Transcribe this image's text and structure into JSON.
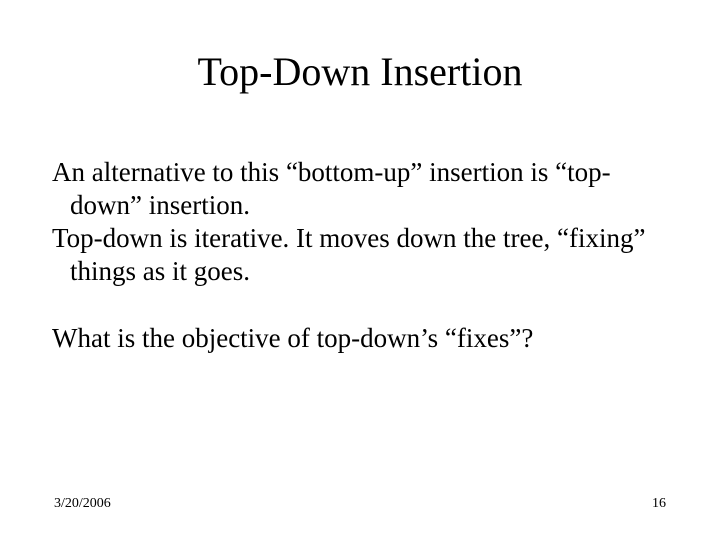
{
  "slide": {
    "title": "Top-Down Insertion",
    "paragraphs": {
      "p1": "An alternative to this “bottom-up” insertion is “top-down” insertion.",
      "p2": "Top-down is iterative.  It moves down the tree, “fixing” things as it goes.",
      "p3": "What is the objective of top-down’s “fixes”?"
    },
    "footer": {
      "date": "3/20/2006",
      "page": "16"
    }
  }
}
